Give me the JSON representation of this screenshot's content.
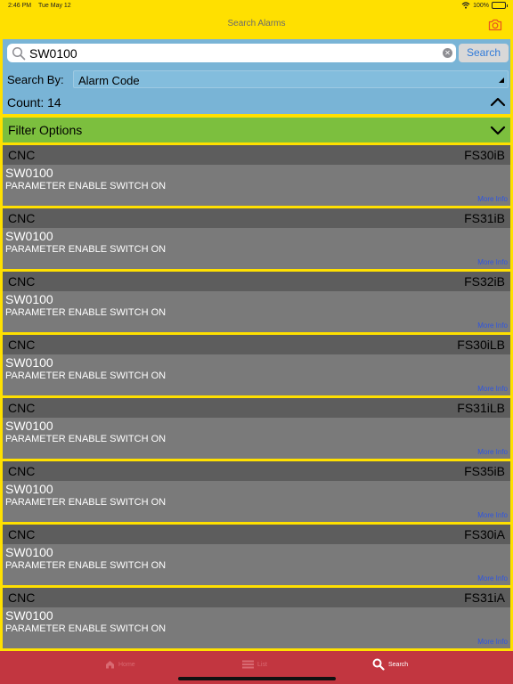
{
  "status_bar": {
    "time": "2:46 PM",
    "date": "Tue May 12",
    "battery": "100%",
    "battery_level": 1.0,
    "wifi_icon": "wifi-icon"
  },
  "nav": {
    "title": "Search Alarms",
    "camera_icon": "camera-icon"
  },
  "search": {
    "query": "SW0100",
    "button_label": "Search",
    "search_by_label": "Search By:",
    "search_by_value": "Alarm Code",
    "count_label": "Count: 14"
  },
  "filter": {
    "label": "Filter Options"
  },
  "results": [
    {
      "type": "CNC",
      "model": "FS30iB",
      "code": "SW0100",
      "description": "PARAMETER ENABLE SWITCH ON",
      "more": "More Info"
    },
    {
      "type": "CNC",
      "model": "FS31iB",
      "code": "SW0100",
      "description": "PARAMETER ENABLE SWITCH ON",
      "more": "More Info"
    },
    {
      "type": "CNC",
      "model": "FS32iB",
      "code": "SW0100",
      "description": "PARAMETER ENABLE SWITCH ON",
      "more": "More Info"
    },
    {
      "type": "CNC",
      "model": "FS30iLB",
      "code": "SW0100",
      "description": "PARAMETER ENABLE SWITCH ON",
      "more": "More Info"
    },
    {
      "type": "CNC",
      "model": "FS31iLB",
      "code": "SW0100",
      "description": "PARAMETER ENABLE SWITCH ON",
      "more": "More Info"
    },
    {
      "type": "CNC",
      "model": "FS35iB",
      "code": "SW0100",
      "description": "PARAMETER ENABLE SWITCH ON",
      "more": "More Info"
    },
    {
      "type": "CNC",
      "model": "FS30iA",
      "code": "SW0100",
      "description": "PARAMETER ENABLE SWITCH ON",
      "more": "More Info"
    },
    {
      "type": "CNC",
      "model": "FS31iA",
      "code": "SW0100",
      "description": "PARAMETER ENABLE SWITCH ON",
      "more": "More Info"
    }
  ],
  "tabs": [
    {
      "label": "Home",
      "icon": "home-icon",
      "active": false
    },
    {
      "label": "List",
      "icon": "list-icon",
      "active": false
    },
    {
      "label": "Search",
      "icon": "search-icon",
      "active": true
    }
  ],
  "colors": {
    "background": "#FFE000",
    "search_panel": "#79B4D6",
    "filter_bar": "#7CBF3E",
    "card_header": "#5D5D5D",
    "card_body": "#7A7A7A",
    "tab_bar": "#C23640",
    "link": "#2F55E0"
  }
}
